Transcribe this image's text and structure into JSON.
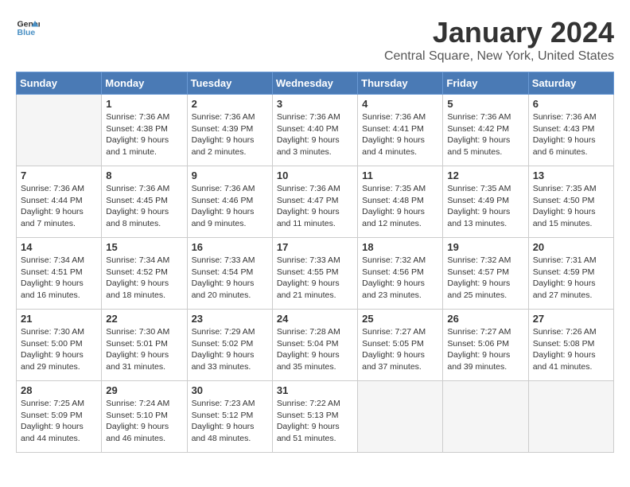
{
  "header": {
    "logo_line1": "General",
    "logo_line2": "Blue",
    "title": "January 2024",
    "subtitle": "Central Square, New York, United States"
  },
  "days_of_week": [
    "Sunday",
    "Monday",
    "Tuesday",
    "Wednesday",
    "Thursday",
    "Friday",
    "Saturday"
  ],
  "weeks": [
    [
      {
        "day": "",
        "info": ""
      },
      {
        "day": "1",
        "info": "Sunrise: 7:36 AM\nSunset: 4:38 PM\nDaylight: 9 hours\nand 1 minute."
      },
      {
        "day": "2",
        "info": "Sunrise: 7:36 AM\nSunset: 4:39 PM\nDaylight: 9 hours\nand 2 minutes."
      },
      {
        "day": "3",
        "info": "Sunrise: 7:36 AM\nSunset: 4:40 PM\nDaylight: 9 hours\nand 3 minutes."
      },
      {
        "day": "4",
        "info": "Sunrise: 7:36 AM\nSunset: 4:41 PM\nDaylight: 9 hours\nand 4 minutes."
      },
      {
        "day": "5",
        "info": "Sunrise: 7:36 AM\nSunset: 4:42 PM\nDaylight: 9 hours\nand 5 minutes."
      },
      {
        "day": "6",
        "info": "Sunrise: 7:36 AM\nSunset: 4:43 PM\nDaylight: 9 hours\nand 6 minutes."
      }
    ],
    [
      {
        "day": "7",
        "info": "Sunrise: 7:36 AM\nSunset: 4:44 PM\nDaylight: 9 hours\nand 7 minutes."
      },
      {
        "day": "8",
        "info": "Sunrise: 7:36 AM\nSunset: 4:45 PM\nDaylight: 9 hours\nand 8 minutes."
      },
      {
        "day": "9",
        "info": "Sunrise: 7:36 AM\nSunset: 4:46 PM\nDaylight: 9 hours\nand 9 minutes."
      },
      {
        "day": "10",
        "info": "Sunrise: 7:36 AM\nSunset: 4:47 PM\nDaylight: 9 hours\nand 11 minutes."
      },
      {
        "day": "11",
        "info": "Sunrise: 7:35 AM\nSunset: 4:48 PM\nDaylight: 9 hours\nand 12 minutes."
      },
      {
        "day": "12",
        "info": "Sunrise: 7:35 AM\nSunset: 4:49 PM\nDaylight: 9 hours\nand 13 minutes."
      },
      {
        "day": "13",
        "info": "Sunrise: 7:35 AM\nSunset: 4:50 PM\nDaylight: 9 hours\nand 15 minutes."
      }
    ],
    [
      {
        "day": "14",
        "info": "Sunrise: 7:34 AM\nSunset: 4:51 PM\nDaylight: 9 hours\nand 16 minutes."
      },
      {
        "day": "15",
        "info": "Sunrise: 7:34 AM\nSunset: 4:52 PM\nDaylight: 9 hours\nand 18 minutes."
      },
      {
        "day": "16",
        "info": "Sunrise: 7:33 AM\nSunset: 4:54 PM\nDaylight: 9 hours\nand 20 minutes."
      },
      {
        "day": "17",
        "info": "Sunrise: 7:33 AM\nSunset: 4:55 PM\nDaylight: 9 hours\nand 21 minutes."
      },
      {
        "day": "18",
        "info": "Sunrise: 7:32 AM\nSunset: 4:56 PM\nDaylight: 9 hours\nand 23 minutes."
      },
      {
        "day": "19",
        "info": "Sunrise: 7:32 AM\nSunset: 4:57 PM\nDaylight: 9 hours\nand 25 minutes."
      },
      {
        "day": "20",
        "info": "Sunrise: 7:31 AM\nSunset: 4:59 PM\nDaylight: 9 hours\nand 27 minutes."
      }
    ],
    [
      {
        "day": "21",
        "info": "Sunrise: 7:30 AM\nSunset: 5:00 PM\nDaylight: 9 hours\nand 29 minutes."
      },
      {
        "day": "22",
        "info": "Sunrise: 7:30 AM\nSunset: 5:01 PM\nDaylight: 9 hours\nand 31 minutes."
      },
      {
        "day": "23",
        "info": "Sunrise: 7:29 AM\nSunset: 5:02 PM\nDaylight: 9 hours\nand 33 minutes."
      },
      {
        "day": "24",
        "info": "Sunrise: 7:28 AM\nSunset: 5:04 PM\nDaylight: 9 hours\nand 35 minutes."
      },
      {
        "day": "25",
        "info": "Sunrise: 7:27 AM\nSunset: 5:05 PM\nDaylight: 9 hours\nand 37 minutes."
      },
      {
        "day": "26",
        "info": "Sunrise: 7:27 AM\nSunset: 5:06 PM\nDaylight: 9 hours\nand 39 minutes."
      },
      {
        "day": "27",
        "info": "Sunrise: 7:26 AM\nSunset: 5:08 PM\nDaylight: 9 hours\nand 41 minutes."
      }
    ],
    [
      {
        "day": "28",
        "info": "Sunrise: 7:25 AM\nSunset: 5:09 PM\nDaylight: 9 hours\nand 44 minutes."
      },
      {
        "day": "29",
        "info": "Sunrise: 7:24 AM\nSunset: 5:10 PM\nDaylight: 9 hours\nand 46 minutes."
      },
      {
        "day": "30",
        "info": "Sunrise: 7:23 AM\nSunset: 5:12 PM\nDaylight: 9 hours\nand 48 minutes."
      },
      {
        "day": "31",
        "info": "Sunrise: 7:22 AM\nSunset: 5:13 PM\nDaylight: 9 hours\nand 51 minutes."
      },
      {
        "day": "",
        "info": ""
      },
      {
        "day": "",
        "info": ""
      },
      {
        "day": "",
        "info": ""
      }
    ]
  ]
}
